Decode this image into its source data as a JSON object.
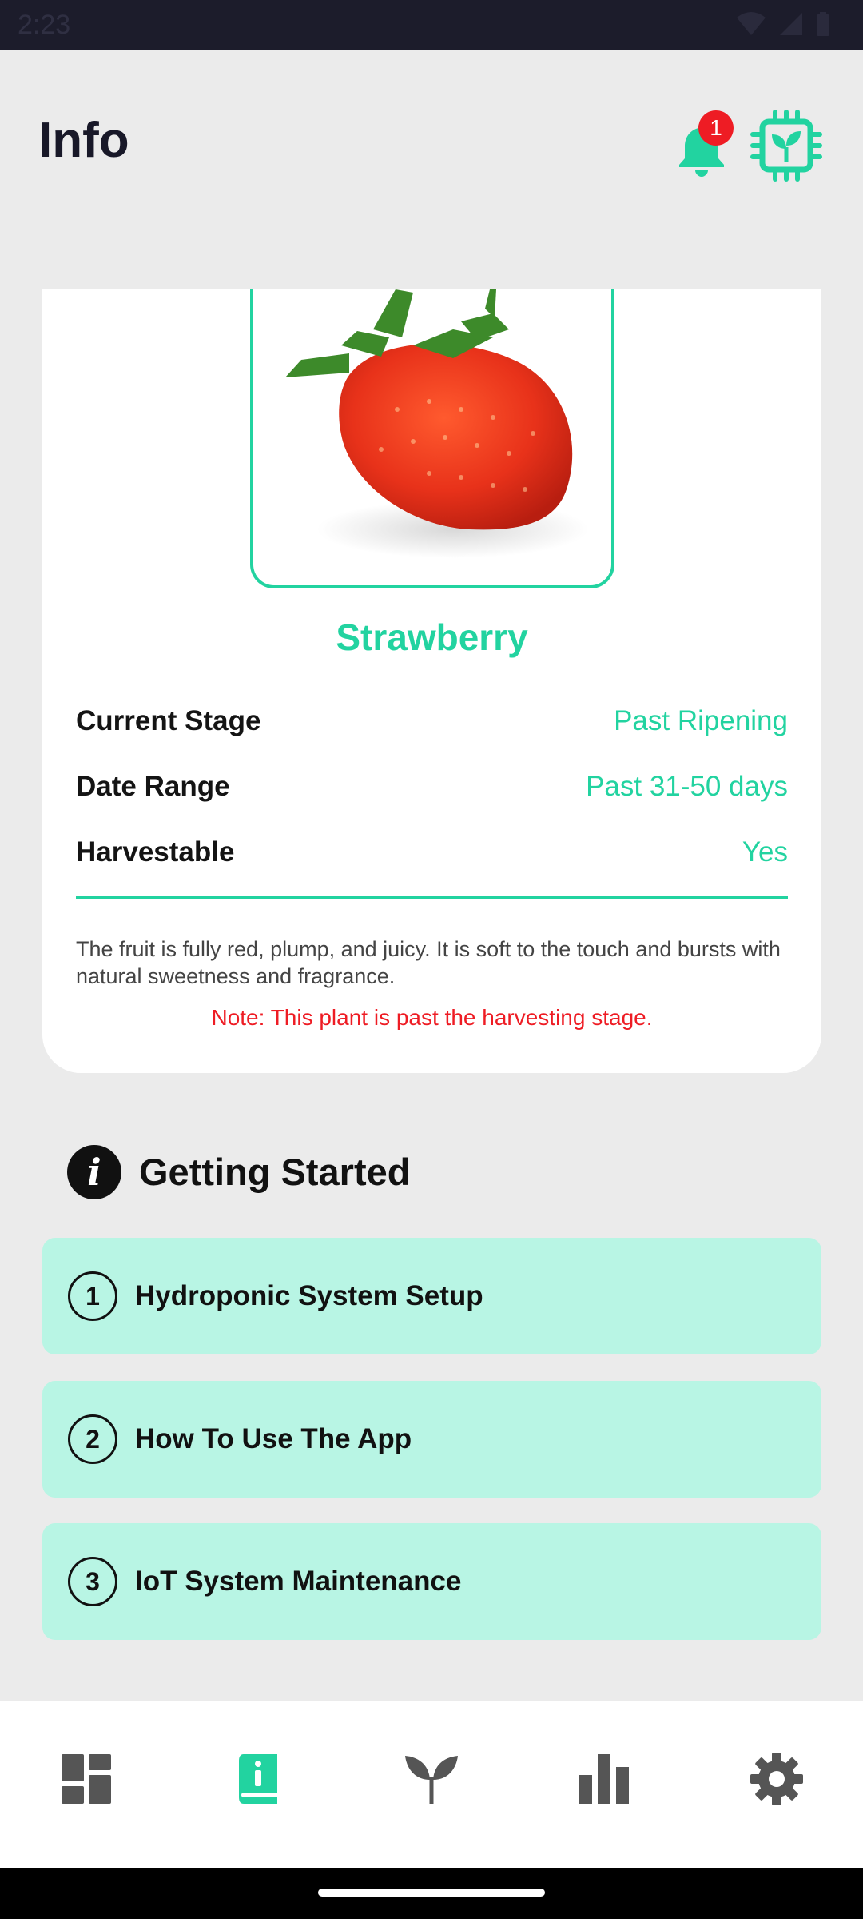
{
  "status_bar": {
    "time": "2:23"
  },
  "header": {
    "title": "Info",
    "notification_count": "1",
    "accent_color": "#22d3a0"
  },
  "plant": {
    "name": "Strawberry",
    "rows": [
      {
        "label": "Current Stage",
        "value": "Past Ripening"
      },
      {
        "label": "Date Range",
        "value": "Past 31-50 days"
      },
      {
        "label": "Harvestable",
        "value": "Yes"
      }
    ],
    "description": "The fruit is fully red, plump, and juicy. It is soft to the touch and bursts with natural sweetness and fragrance.",
    "note": "Note: This plant is past the harvesting stage."
  },
  "getting_started": {
    "title": "Getting Started",
    "icon_letter": "i",
    "items": [
      {
        "number": "1",
        "label": "Hydroponic System Setup"
      },
      {
        "number": "2",
        "label": "How To Use The App"
      },
      {
        "number": "3",
        "label": "IoT System Maintenance"
      }
    ]
  },
  "bottom_nav": {
    "items": [
      "dashboard-icon",
      "info-book-icon",
      "plant-sprout-icon",
      "bar-chart-icon",
      "gear-icon"
    ],
    "active": "info-book-icon",
    "active_color": "#22d3a0",
    "inactive_color": "#555555"
  }
}
